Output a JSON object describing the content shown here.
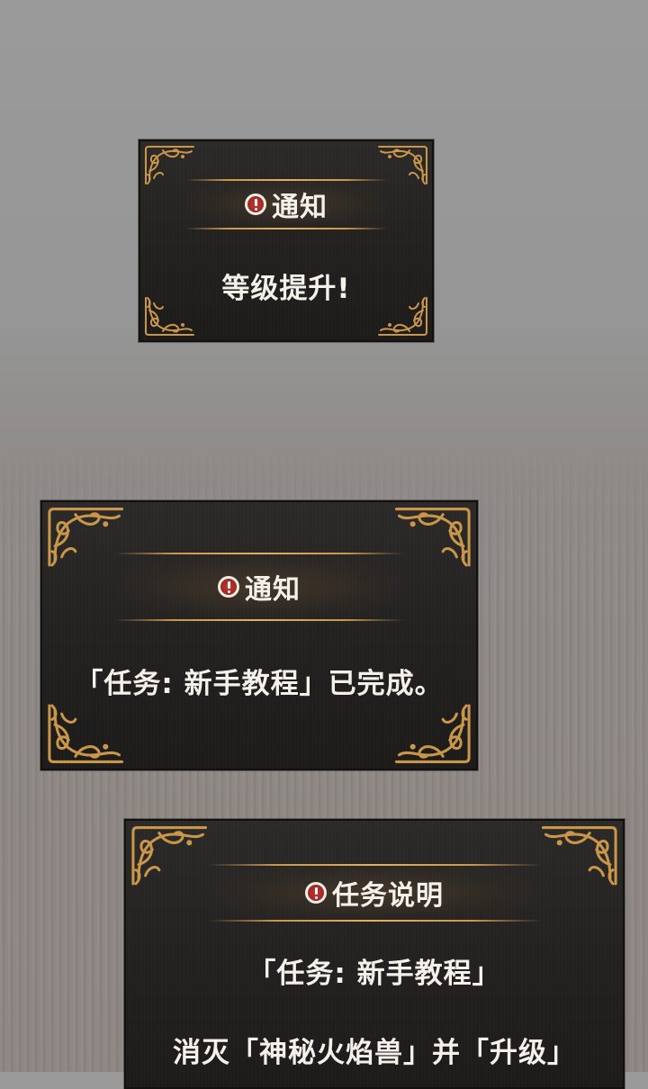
{
  "panels": [
    {
      "title": "通知",
      "lines": [
        "等级提升!"
      ]
    },
    {
      "title": "通知",
      "lines": [
        "「任务: 新手教程」已完成。"
      ]
    },
    {
      "title": "任务说明",
      "lines": [
        "「任务: 新手教程」",
        "消灭「神秘火焰兽」并「升级」"
      ]
    }
  ],
  "icons": {
    "alert": "exclamation-circle-icon",
    "corner": "gold-filigree-corner"
  },
  "colors": {
    "panel": "#222120",
    "gold": "#c9964a",
    "alert": "#c23a32",
    "text": "#f4f1ea",
    "background": "#969696"
  }
}
